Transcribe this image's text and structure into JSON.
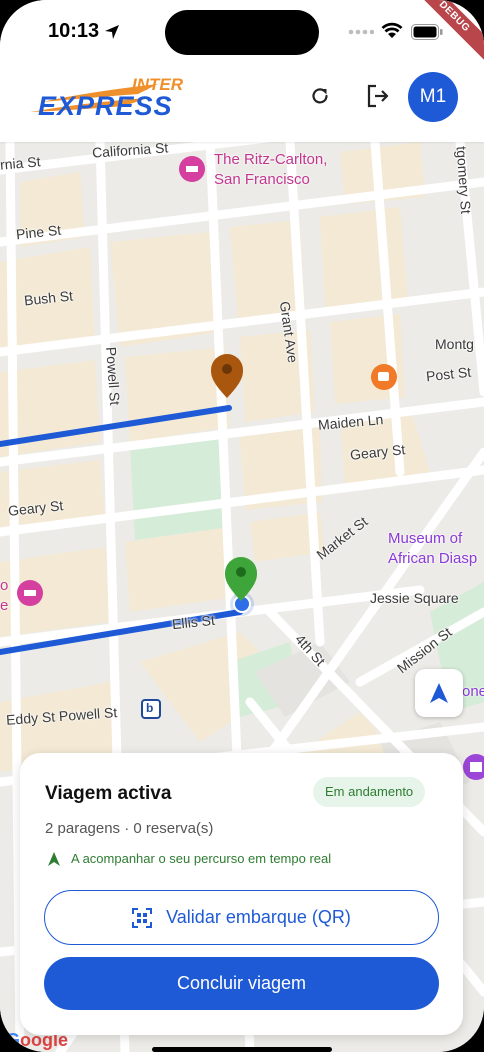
{
  "status_bar": {
    "time": "10:13",
    "debug_label": "DEBUG"
  },
  "app_bar": {
    "logo_top": "INTER",
    "logo_bottom": "EXPRESS",
    "avatar_initials": "M1",
    "colors": {
      "brand_blue": "#1f5ad6",
      "brand_orange": "#f0902c"
    }
  },
  "map": {
    "streets": {
      "california": "California St",
      "nia": "rnia St",
      "pine": "Pine St",
      "bush": "Bush St",
      "powell": "Powell St",
      "grant": "Grant Ave",
      "post": "Post St",
      "maiden": "Maiden Ln",
      "geary_east": "Geary St",
      "geary_west": "Geary St",
      "market": "Market St",
      "ellis": "Ellis St",
      "fourth": "4th St",
      "mission": "Mission St",
      "eddy_powell": "Eddy St  Powell St",
      "montg": "Montg",
      "tgomery": "tgomery St"
    },
    "pois": {
      "ritz_line1": "The Ritz-Carlton,",
      "ritz_line2": "San Francisco",
      "museum_line1": "Museum of",
      "museum_line2": "African Diasp",
      "jessie_square": "Jessie Square",
      "left_poi": "o",
      "left_poi2": "e",
      "bart": "b",
      "one": "one"
    },
    "google_logo": "oogle"
  },
  "trip_card": {
    "title": "Viagem activa",
    "status": "Em andamento",
    "summary": "2 paragens · 0 reserva(s)",
    "tracking": "A acompanhar o seu percurso em tempo real",
    "validate_label": "Validar embarque (QR)",
    "conclude_label": "Concluir viagem"
  }
}
